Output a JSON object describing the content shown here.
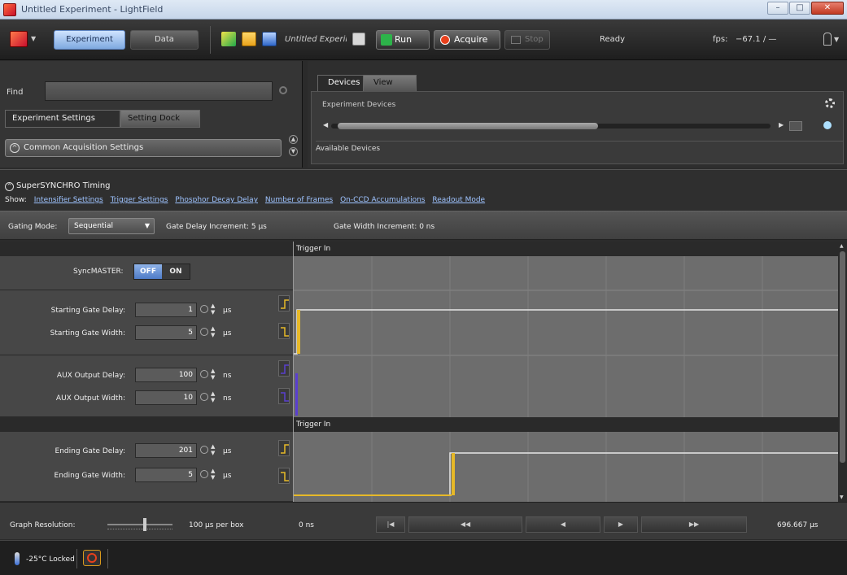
{
  "window": {
    "title": "Untitled Experiment - LightField"
  },
  "toolbar": {
    "tab_experiment": "Experiment",
    "tab_data": "Data",
    "experiment_name": "Untitled Experim",
    "run": "Run",
    "acquire": "Acquire",
    "stop": "Stop",
    "status": "Ready",
    "fps_label": "fps:",
    "temp_readout": "−67.1 / —"
  },
  "left_panel": {
    "find_label": "Find",
    "find_value": "",
    "tabs": [
      "Experiment Settings",
      "Setting Dock"
    ],
    "common_acq": "Common Acquisition Settings"
  },
  "right_panel": {
    "tabs": [
      "Devices",
      "View"
    ],
    "experiment_devices": "Experiment Devices",
    "available_devices": "Available Devices"
  },
  "supersynchro": {
    "title": "SuperSYNCHRO Timing",
    "show_label": "Show:",
    "show_links": [
      "Intensifier Settings",
      "Trigger Settings",
      "Phosphor Decay Delay",
      "Number of Frames",
      "On-CCD Accumulations",
      "Readout Mode"
    ],
    "gating_mode_label": "Gating Mode:",
    "gating_mode_value": "Sequential",
    "gate_delay_inc": "Gate Delay Increment: 5 µs",
    "gate_width_inc": "Gate Width Increment: 0 ns",
    "syncmaster_label": "SyncMASTER:",
    "toggle_off": "OFF",
    "toggle_on": "ON",
    "params": [
      {
        "label": "Starting Gate Delay:",
        "value": "1",
        "unit": "µs"
      },
      {
        "label": "Starting Gate Width:",
        "value": "5",
        "unit": "µs"
      },
      {
        "label": "AUX Output Delay:",
        "value": "100",
        "unit": "ns"
      },
      {
        "label": "AUX Output Width:",
        "value": "10",
        "unit": "ns"
      },
      {
        "label": "Ending Gate Delay:",
        "value": "201",
        "unit": "µs"
      },
      {
        "label": "Ending Gate Width:",
        "value": "5",
        "unit": "µs"
      }
    ],
    "trigger_in": "Trigger In",
    "trigger_in_2": "Trigger In"
  },
  "graph": {
    "resolution_label": "Graph Resolution:",
    "resolution_value": "100 µs per box",
    "time_start": "0 ns",
    "time_end": "696.667 µs",
    "nav": [
      "|◀",
      "◀◀",
      "◀",
      "▶",
      "▶▶"
    ]
  },
  "statusbar": {
    "temperature": "-25°C Locked"
  },
  "colors": {
    "gate": "#e7b928",
    "aux": "#5a3fd0",
    "trace": "#e6e6e6",
    "accent": "#5d84c2"
  }
}
